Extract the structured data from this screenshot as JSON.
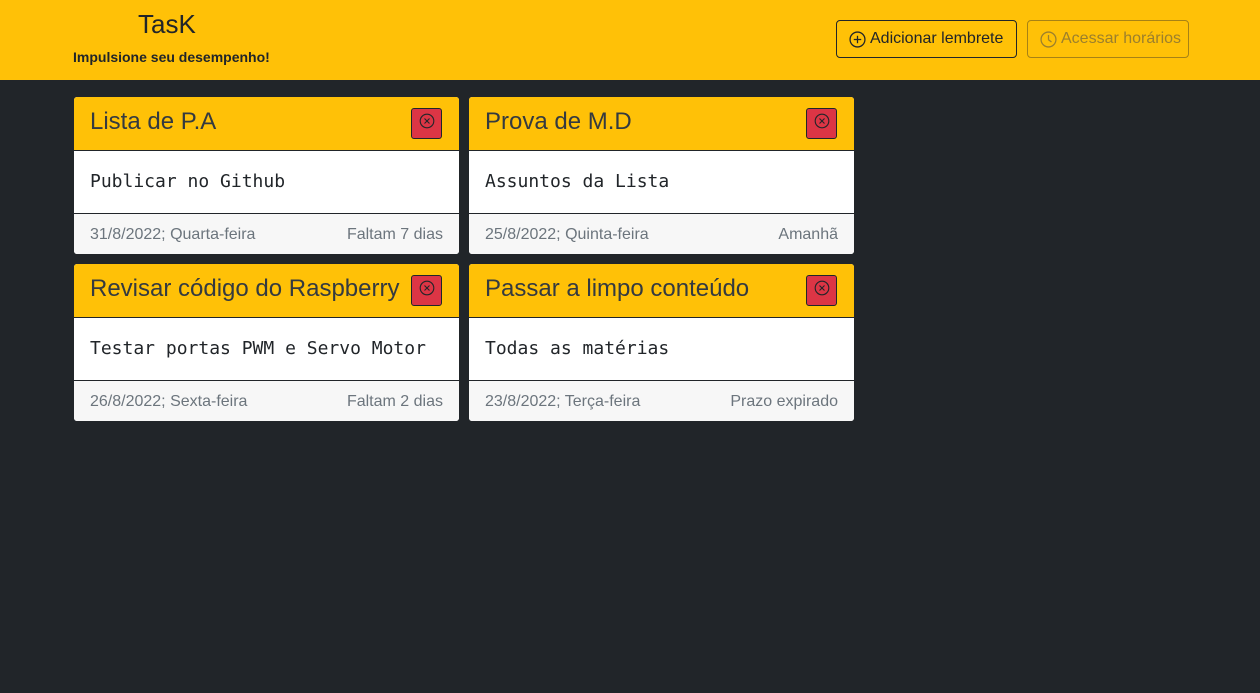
{
  "header": {
    "title": "TasK",
    "subtitle": "Impulsione seu desempenho!",
    "add_label": "Adicionar lembrete",
    "add_icon": "plus-circle-icon",
    "schedule_label": "Acessar horários",
    "schedule_icon": "clock-icon"
  },
  "colors": {
    "accent": "#ffc107",
    "background": "#212529",
    "danger": "#dc3545"
  },
  "cards": [
    {
      "title": "Lista de P.A",
      "text": "Publicar no Github",
      "date": "31/8/2022; Quarta-feira",
      "status": "Faltam 7 dias",
      "delete_icon": "x-circle-icon"
    },
    {
      "title": "Prova de M.D",
      "text": "Assuntos da Lista",
      "date": "25/8/2022; Quinta-feira",
      "status": "Amanhã",
      "delete_icon": "x-circle-icon"
    },
    {
      "title": "Revisar código do Raspberry",
      "text": "Testar portas PWM e Servo Motor",
      "date": "26/8/2022; Sexta-feira",
      "status": "Faltam 2 dias",
      "delete_icon": "x-circle-icon"
    },
    {
      "title": "Passar a limpo conteúdo",
      "text": "Todas as matérias",
      "date": "23/8/2022; Terça-feira",
      "status": "Prazo expirado",
      "delete_icon": "x-circle-icon"
    }
  ]
}
